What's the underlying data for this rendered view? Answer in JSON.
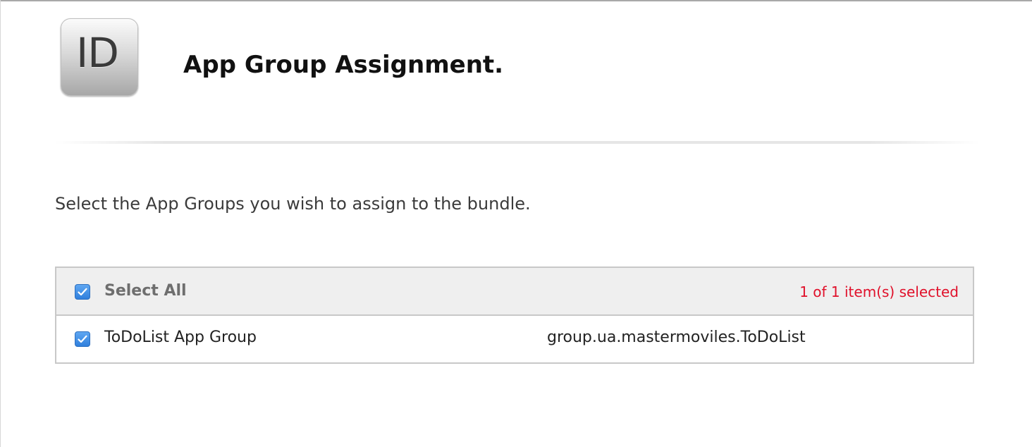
{
  "header": {
    "icon_text": "ID",
    "title": "App Group Assignment."
  },
  "instruction": "Select the App Groups you wish to assign to the bundle.",
  "table": {
    "select_all": {
      "label": "Select All",
      "checked": true
    },
    "selection_status": "1 of 1 item(s) selected",
    "rows": [
      {
        "name": "ToDoList App Group",
        "identifier": "group.ua.mastermoviles.ToDoList",
        "checked": true
      }
    ]
  },
  "colors": {
    "checkbox_accent": "#2f7fdc",
    "selection_status": "#e0102a",
    "table_header_bg": "#efefef",
    "table_border": "#c8c8c8"
  },
  "icons": {
    "app_id_icon": "app-id-icon",
    "checkbox_icon": "checkbox-checked-icon"
  }
}
